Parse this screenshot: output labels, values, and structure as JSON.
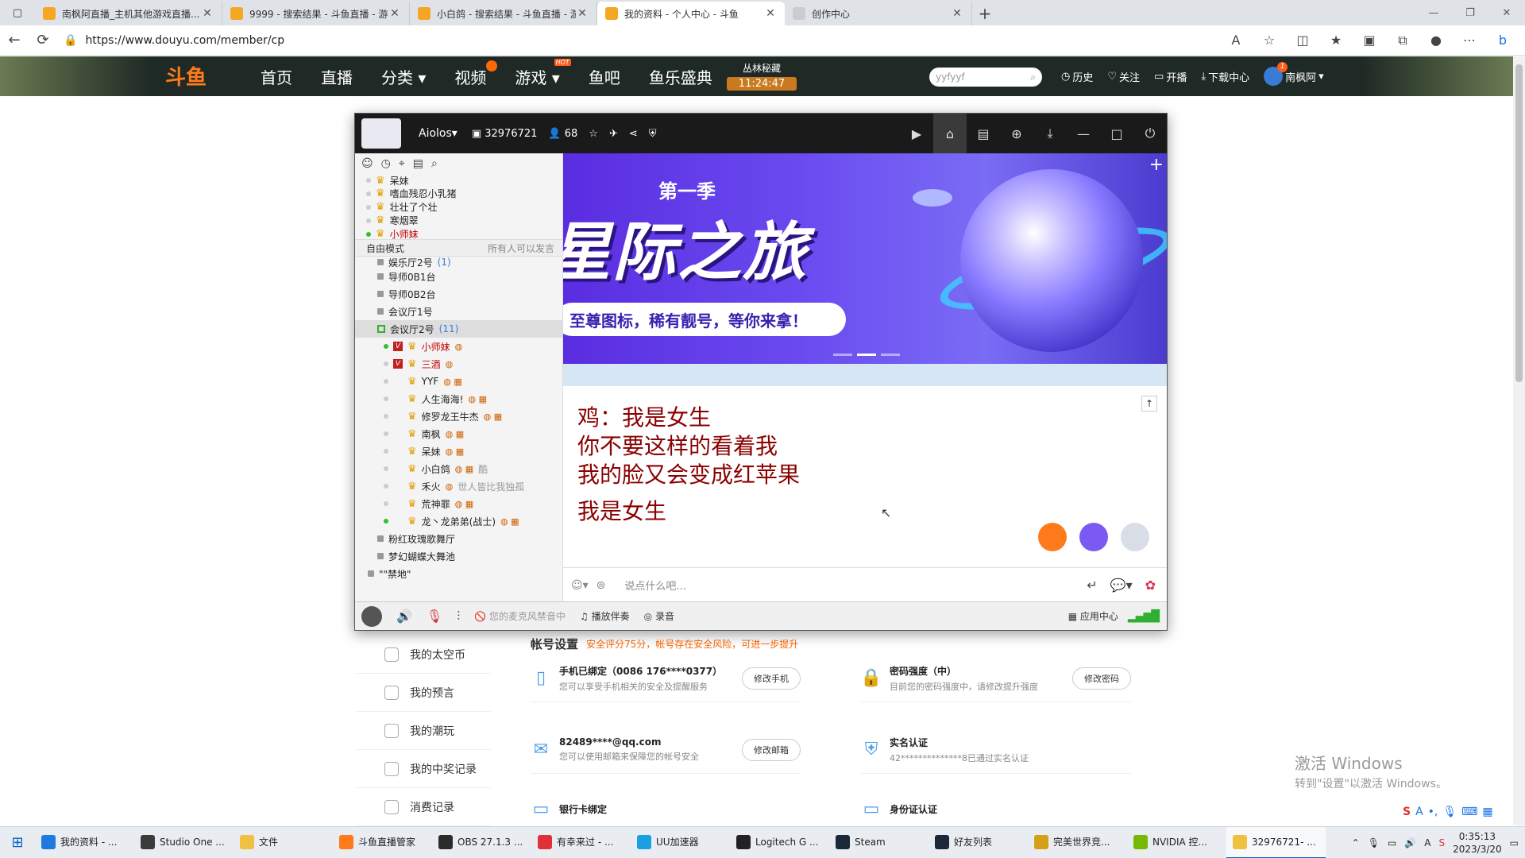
{
  "browser": {
    "tabs": [
      {
        "title": "南枫阿直播_主机其他游戏直播...",
        "active": false
      },
      {
        "title": "9999 - 搜索结果 - 斗鱼直播 - 游...",
        "active": false
      },
      {
        "title": "小白鸽 - 搜索结果 - 斗鱼直播 - 游...",
        "active": false
      },
      {
        "title": "我的资料 - 个人中心 - 斗鱼",
        "active": true
      },
      {
        "title": "创作中心",
        "active": false
      }
    ],
    "url": "https://www.douyu.com/member/cp"
  },
  "douyu": {
    "logo": "斗鱼",
    "nav": [
      "首页",
      "直播",
      "分类",
      "视频",
      "游戏",
      "鱼吧",
      "鱼乐盛典"
    ],
    "hot_badge": "HOT",
    "promo_title": "丛林秘藏",
    "promo_timer": "11:24:47",
    "search_value": "yyfyyf",
    "right_links": [
      "历史",
      "关注",
      "开播",
      "下载中心"
    ],
    "username": "南枫阿",
    "notif_count": "1"
  },
  "yy": {
    "user": "Aiolos",
    "room_id": "32976721",
    "online": "68",
    "top_list": [
      {
        "name": "呆妹",
        "online": false
      },
      {
        "name": "嗜血残忍小乳猪",
        "online": false
      },
      {
        "name": "壮壮了个壮",
        "online": false
      },
      {
        "name": "寒烟翠",
        "online": false
      },
      {
        "name": "小师妹",
        "online": true,
        "red": true
      }
    ],
    "mode_left": "自由模式",
    "mode_right": "所有人可以发言",
    "channels_top": [
      {
        "name": "娱乐厅2号",
        "count": "(1)"
      },
      {
        "name": "导师0B1台",
        "count": ""
      },
      {
        "name": "导师0B2台",
        "count": ""
      },
      {
        "name": "会议厅1号",
        "count": ""
      }
    ],
    "selected_channel": {
      "name": "会议厅2号",
      "count": "(11)"
    },
    "members": [
      {
        "name": "小师妹",
        "online": true,
        "vip": true,
        "red": true,
        "extra": ""
      },
      {
        "name": "三酒",
        "online": false,
        "vip": true,
        "red": true,
        "extra": ""
      },
      {
        "name": "YYF",
        "online": false,
        "vip": false,
        "red": false,
        "extra": ""
      },
      {
        "name": "人生海海!",
        "online": false,
        "vip": false,
        "red": false,
        "extra": ""
      },
      {
        "name": "修罗龙王牛杰",
        "online": false,
        "vip": false,
        "red": false,
        "extra": ""
      },
      {
        "name": "南枫",
        "online": false,
        "vip": false,
        "red": false,
        "extra": ""
      },
      {
        "name": "呆妹",
        "online": false,
        "vip": false,
        "red": false,
        "extra": ""
      },
      {
        "name": "小白鸽",
        "online": false,
        "vip": false,
        "red": false,
        "extra": "酷"
      },
      {
        "name": "禾火",
        "online": false,
        "vip": false,
        "red": false,
        "extra": "世人皆比我独孤"
      },
      {
        "name": "荒神罪",
        "online": false,
        "vip": false,
        "red": false,
        "extra": ""
      },
      {
        "name": "龙丶龙弟弟(战士)",
        "online": true,
        "vip": false,
        "red": false,
        "extra": ""
      }
    ],
    "channels_bottom": [
      "粉红玫瑰歌舞厅",
      "梦幻蝴蝶大舞池",
      "\"\"禁地\""
    ],
    "banner": {
      "season": "第一季",
      "headline": "星际之旅",
      "pill": "至尊图标，稀有靓号，等你来拿！"
    },
    "chat_lines": [
      "鸡：我是女生",
      "你不要这样的看着我",
      "我的脸又会变成红苹果",
      "我是女生"
    ],
    "input_placeholder": "说点什么吧...",
    "bottom": {
      "mic_status": "您的麦克风禁音中",
      "accompany": "播放伴奏",
      "record": "录音",
      "app_center": "应用中心"
    }
  },
  "profile": {
    "menu": [
      "我的太空币",
      "我的预言",
      "我的潮玩",
      "我的中奖记录",
      "消费记录"
    ],
    "account_title": "帐号设置",
    "security_note": "安全评分75分，帐号存在安全风险，可进一步提升",
    "items": [
      {
        "head": "手机已绑定（0086 176****0377）",
        "sub": "您可以享受手机相关的安全及提醒服务",
        "btn": "修改手机"
      },
      {
        "head": "密码强度（中）",
        "sub": "目前您的密码强度中，请修改提升强度",
        "btn": "修改密码"
      },
      {
        "head": "82489****@qq.com",
        "sub": "您可以使用邮箱来保障您的帐号安全",
        "btn": "修改邮箱"
      },
      {
        "head": "实名认证",
        "sub": "42**************8已通过实名认证",
        "btn": ""
      },
      {
        "head": "银行卡绑定",
        "sub": "",
        "btn": ""
      },
      {
        "head": "身份证认证",
        "sub": "",
        "btn": ""
      }
    ]
  },
  "windows": {
    "activate_title": "激活 Windows",
    "activate_sub": "转到\"设置\"以激活 Windows。"
  },
  "taskbar": {
    "items": [
      {
        "label": "我的资料 - ...",
        "color": "#1f7ae0",
        "active": false
      },
      {
        "label": "Studio One ...",
        "color": "#3b3b3b",
        "active": false
      },
      {
        "label": "文件",
        "color": "#f0c040",
        "active": false
      },
      {
        "label": "斗鱼直播管家",
        "color": "#ff7a1a",
        "active": false
      },
      {
        "label": "OBS 27.1.3 ...",
        "color": "#2b2b2b",
        "active": false
      },
      {
        "label": "有幸来过 - ...",
        "color": "#e0303a",
        "active": false
      },
      {
        "label": "UU加速器",
        "color": "#1aa0e0",
        "active": false
      },
      {
        "label": "Logitech G ...",
        "color": "#222222",
        "active": false
      },
      {
        "label": "Steam",
        "color": "#1b2838",
        "active": false
      },
      {
        "label": "好友列表",
        "color": "#1b2838",
        "active": false
      },
      {
        "label": "完美世界竞...",
        "color": "#d4a017",
        "active": false
      },
      {
        "label": "NVIDIA 控...",
        "color": "#76b900",
        "active": false
      },
      {
        "label": "32976721- ...",
        "color": "#f0c040",
        "active": true
      }
    ],
    "time": "0:35:13",
    "date": "2023/3/20",
    "ime_lang": "A"
  }
}
